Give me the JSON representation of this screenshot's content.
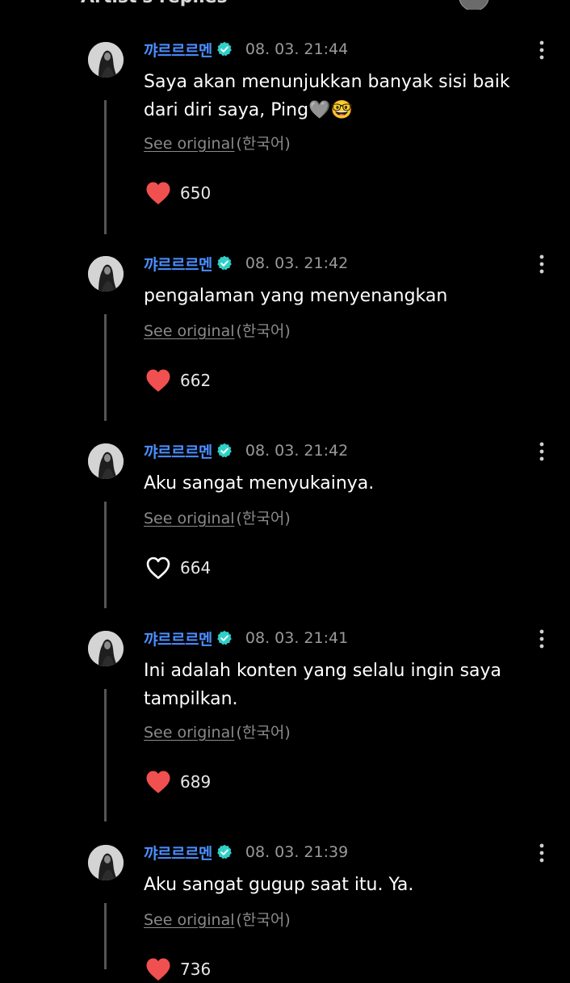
{
  "header": {
    "title": "Artist's replies"
  },
  "comments": [
    {
      "author": "꺄르르르멘",
      "timestamp": "08. 03. 21:44",
      "text": "Saya akan menunjukkan banyak sisi baik dari diri saya, Ping🩶🤓",
      "see_original": "See original",
      "language": "(한국어)",
      "likes": "650",
      "liked": true
    },
    {
      "author": "꺄르르르멘",
      "timestamp": "08. 03. 21:42",
      "text": "pengalaman yang menyenangkan",
      "see_original": "See original",
      "language": "(한국어)",
      "likes": "662",
      "liked": true
    },
    {
      "author": "꺄르르르멘",
      "timestamp": "08. 03. 21:42",
      "text": "Aku sangat menyukainya.",
      "see_original": "See original",
      "language": "(한국어)",
      "likes": "664",
      "liked": false
    },
    {
      "author": "꺄르르르멘",
      "timestamp": "08. 03. 21:41",
      "text": "Ini adalah konten yang selalu ingin saya tampilkan.",
      "see_original": "See original",
      "language": "(한국어)",
      "likes": "689",
      "liked": true
    },
    {
      "author": "꺄르르르멘",
      "timestamp": "08. 03. 21:39",
      "text": "Aku sangat gugup saat itu. Ya.",
      "see_original": "See original",
      "language": "(한국어)",
      "likes": "736",
      "liked": true
    }
  ],
  "colors": {
    "background": "#000000",
    "author": "#4a8eff",
    "verified": "#2fd0c8",
    "heart_liked": "#f0504f",
    "muted_text": "#8a8a8a",
    "thread_line": "#555555"
  },
  "icons": {
    "verified": "verified-badge-icon",
    "more": "more-vertical-icon",
    "heart_filled": "heart-filled-icon",
    "heart_outline": "heart-outline-icon"
  }
}
